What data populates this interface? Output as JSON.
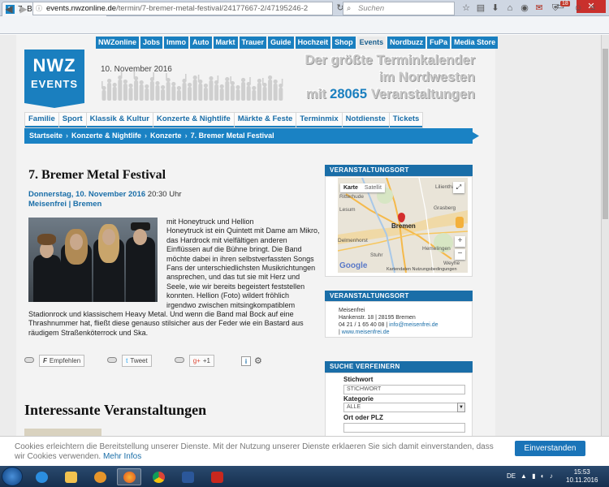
{
  "browser": {
    "tab_title": "7. Bremer Metal Festival - ...",
    "favicon_text": "N",
    "url_host": "events.nwzonline.de",
    "url_path": "/termin/7-bremer-metal-festival/24177667-2/47195246-2",
    "search_placeholder": "Suchen",
    "badge_count": "18"
  },
  "top_nav": [
    "NWZonline",
    "Jobs",
    "Immo",
    "Auto",
    "Markt",
    "Trauer",
    "Guide",
    "Hochzeit",
    "Shop",
    "Events",
    "Nordbuzz",
    "FuPa",
    "Media Store"
  ],
  "top_nav_active": "Events",
  "logo": {
    "line1": "NWZ",
    "line2": "EVENTS"
  },
  "header_date": "10. November 2016",
  "slogan": {
    "line1": "Der größte Terminkalender",
    "line2": "im Nordwesten",
    "line3_pre": "mit",
    "count": "28065",
    "line3_post": "Veranstaltungen"
  },
  "category_nav": [
    "Familie",
    "Sport",
    "Klassik & Kultur",
    "Konzerte & Nightlife",
    "Märkte & Feste",
    "Terminmix",
    "Notdienste",
    "Tickets"
  ],
  "breadcrumb": [
    "Startseite",
    "Konzerte & Nightlife",
    "Konzerte",
    "7. Bremer Metal Festival"
  ],
  "article": {
    "title": "7. Bremer Metal Festival",
    "date": "Donnerstag, 10. November 2016",
    "time": "20:30 Uhr",
    "venue": "Meisenfrei | Bremen",
    "body_intro": "mit Honeytruck und Hellion",
    "body_text": "Honeytruck ist ein Quintett mit Dame am Mikro, das Hardrock mit vielfältigen anderen Einflüssen auf die Bühne bringt. Die Band möchte dabei in ihren selbstverfassten Songs Fans der unterschiedlichsten Musikrichtungen ansprechen, und das tut sie mit Herz und Seele, wie wir bereits begeistert feststellen konnten. Hellion (Foto) wildert fröhlich irgendwo zwischen mitsingkompatiblem Stadionrock und klassischem Heavy Metal. Und wenn die Band mal Bock auf eine Thrashnummer hat, fließt diese genauso stilsicher aus der Feder wie ein Bastard aus räudigem Straßenköterrock und Ska."
  },
  "share": {
    "facebook": "Empfehlen",
    "twitter": "Tweet",
    "gplus": "+1",
    "facebook_icon": "F",
    "twitter_icon": "t",
    "gplus_icon": "g+"
  },
  "more_heading": "Interessante Veranstaltungen",
  "sidebar": {
    "location_heading": "Veranstaltungsort",
    "map": {
      "tab_map": "Karte",
      "tab_sat": "Satellit",
      "city": "Bremen",
      "labels": [
        "Lilienthal",
        "Lesum",
        "Grasberg",
        "Ritterhude",
        "Delmenhorst",
        "Stuhr",
        "Hemelingen",
        "Weyhe"
      ],
      "footer_data": "Kartendaten",
      "footer_terms": "Nutzungsbedingungen",
      "google": "Google"
    },
    "venue_heading": "Veranstaltungsort",
    "venue_name": "Meisenfrei",
    "venue_address": "Hankenstr. 18 | 28195 Bremen",
    "venue_phone": "04 21 / 1 65 40 08 |",
    "venue_email": "info@meisenfrei.de",
    "venue_web": "www.meisenfrei.de",
    "search_heading": "Suche verfeinern",
    "keyword_label": "Stichwort",
    "keyword_placeholder": "STICHWORT",
    "category_label": "Kategorie",
    "category_value": "ALLE",
    "place_label": "Ort oder PLZ"
  },
  "cookie": {
    "text": "Cookies erleichtern die Bereitstellung unserer Dienste. Mit der Nutzung unserer Dienste erklaeren Sie sich damit einverstanden, dass wir Cookies verwenden.",
    "more": "Mehr Infos",
    "button": "Einverstanden"
  },
  "taskbar": {
    "lang": "DE",
    "time": "15:53",
    "date": "10.11.2016"
  },
  "colors": {
    "brand": "#1a7fbf",
    "crumb": "#1a82c4",
    "cookie_button": "#1a74b8"
  },
  "icons": [
    "nwz-favicon",
    "back-icon",
    "forward-icon",
    "lock-icon",
    "search-icon",
    "reload-icon",
    "star-icon",
    "home-icon",
    "gear-icon",
    "info-icon",
    "map-pin-icon",
    "zoom-in-icon",
    "zoom-out-icon",
    "pegman-icon",
    "fullscreen-icon",
    "windows-start-icon"
  ]
}
